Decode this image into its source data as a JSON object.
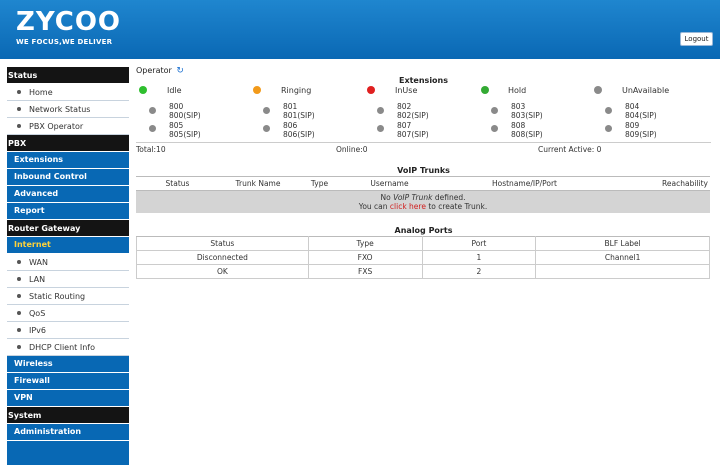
{
  "header": {
    "brand": "ZYCOO",
    "slogan": "WE FOCUS,WE DELIVER",
    "logout_label": "Logout"
  },
  "sidebar": {
    "status_section": "Status",
    "status_items": [
      "Home",
      "Network Status",
      "PBX Operator"
    ],
    "pbx_section": "PBX",
    "pbx_items": [
      "Extensions",
      "Inbound Control",
      "Advanced",
      "Report"
    ],
    "router_section": "Router Gateway",
    "internet_label": "Internet",
    "internet_items": [
      "WAN",
      "LAN",
      "Static Routing",
      "QoS",
      "IPv6",
      "DHCP Client Info"
    ],
    "router_items": [
      "Wireless",
      "Firewall",
      "VPN"
    ],
    "system_section": "System",
    "system_items": [
      "Administration"
    ]
  },
  "operator": {
    "label": "Operator",
    "refresh_icon": "refresh-icon"
  },
  "extensions": {
    "title": "Extensions",
    "legend": [
      {
        "label": "Idle",
        "color": "#2fbf2f"
      },
      {
        "label": "Ringing",
        "color": "#f29a1a"
      },
      {
        "label": "InUse",
        "color": "#e02020"
      },
      {
        "label": "Hold",
        "color": "#33aa33"
      },
      {
        "label": "UnAvailable",
        "color": "#8a8a8a"
      }
    ],
    "items": [
      {
        "num": "800",
        "name": "800(SIP)"
      },
      {
        "num": "801",
        "name": "801(SIP)"
      },
      {
        "num": "802",
        "name": "802(SIP)"
      },
      {
        "num": "803",
        "name": "803(SIP)"
      },
      {
        "num": "804",
        "name": "804(SIP)"
      },
      {
        "num": "805",
        "name": "805(SIP)"
      },
      {
        "num": "806",
        "name": "806(SIP)"
      },
      {
        "num": "807",
        "name": "807(SIP)"
      },
      {
        "num": "808",
        "name": "808(SIP)"
      },
      {
        "num": "809",
        "name": "809(SIP)"
      }
    ],
    "total": "Total:10",
    "online": "Online:0",
    "current_active": "Current Active:  0"
  },
  "voip": {
    "title": "VoIP Trunks",
    "columns": [
      "Status",
      "Trunk Name",
      "Type",
      "Username",
      "Hostname/IP/Port",
      "Reachability"
    ],
    "msg_prefix": "No ",
    "msg_italic": "VoIP Trunk",
    "msg_suffix": " defined.",
    "msg2_prefix": "You can ",
    "msg2_link": "click here",
    "msg2_suffix": " to create Trunk."
  },
  "analog": {
    "title": "Analog Ports",
    "columns": [
      "Status",
      "Type",
      "Port",
      "BLF Label"
    ],
    "rows": [
      {
        "status": "Disconnected",
        "type": "FXO",
        "port": "1",
        "blf": "Channel1"
      },
      {
        "status": "OK",
        "type": "FXS",
        "port": "2",
        "blf": ""
      }
    ]
  }
}
